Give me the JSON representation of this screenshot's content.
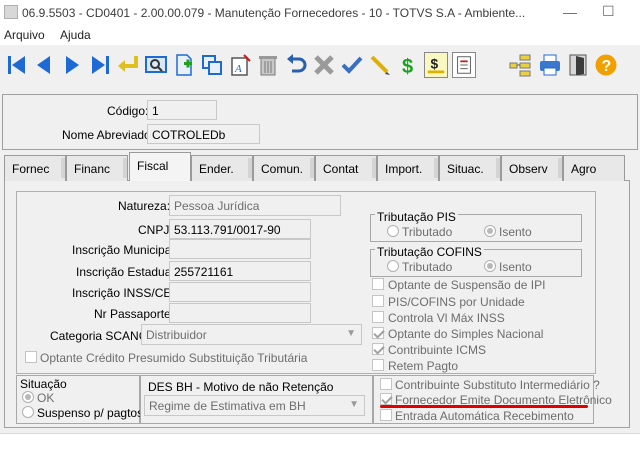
{
  "window": {
    "title": "06.9.5503 - CD0401 - 2.00.00.079 - Manutenção Fornecedores - 10 - TOTVS S.A - Ambiente...",
    "minimize": "—",
    "maximize": "☐",
    "close": "✕"
  },
  "menu": {
    "arquivo": "Arquivo",
    "ajuda": "Ajuda"
  },
  "header": {
    "codigo_label": "Código:",
    "codigo_value": "1",
    "nome_label": "Nome Abreviado:",
    "nome_value": "COTROLEDb"
  },
  "tabs": [
    "Fornec",
    "Financ",
    "Fiscal",
    "Ender.",
    "Comun.",
    "Contat",
    "Import.",
    "Situac.",
    "Observ",
    "Agro"
  ],
  "active_tab": "Fiscal",
  "fiscal": {
    "natureza_label": "Natureza:",
    "natureza_value": "Pessoa Jurídica",
    "cnpj_label": "CNPJ:",
    "cnpj_value": "53.113.791/0017-90",
    "insc_mun_label": "Inscrição Municipal:",
    "insc_mun_value": "",
    "insc_est_label": "Inscrição Estadual:",
    "insc_est_value": "255721161",
    "insc_inss_label": "Inscrição INSS/CEI:",
    "insc_inss_value": "",
    "passaporte_label": "Nr Passaporte:",
    "passaporte_value": "",
    "scanc_label": "Categoria SCANC:",
    "scanc_value": "Distribuidor",
    "optante_credito": "Optante Crédito Presumido Substituição Tributária"
  },
  "trib_pis": {
    "title": "Tributação PIS",
    "opt1": "Tributado",
    "opt2": "Isento",
    "selected": "Isento"
  },
  "trib_cofins": {
    "title": "Tributação COFINS",
    "opt1": "Tributado",
    "opt2": "Isento",
    "selected": "Isento"
  },
  "checks": [
    {
      "label": "Optante de Suspensão de IPI",
      "checked": false
    },
    {
      "label": "PIS/COFINS por Unidade",
      "checked": false
    },
    {
      "label": "Controla Vl Máx INSS",
      "checked": false
    },
    {
      "label": "Optante do Simples Nacional",
      "checked": true
    },
    {
      "label": "Contribuinte ICMS",
      "checked": true
    },
    {
      "label": "Retem Pagto",
      "checked": false
    }
  ],
  "situacao": {
    "title": "Situação",
    "opt1": "OK",
    "opt2": "Suspenso p/ pagtos",
    "selected": "OK"
  },
  "des_bh": {
    "title": "DES BH - Motivo de não Retenção",
    "value": "Regime de Estimativa em BH"
  },
  "checks2": [
    {
      "label": "Contribuinte Substituto Intermediário ?",
      "checked": false
    },
    {
      "label": "Fornecedor Emite Documento Eletrônico",
      "checked": true
    },
    {
      "label": "Entrada Automática Recebimento",
      "checked": false
    }
  ],
  "colors": {
    "highlight_underline": "#e00000",
    "toolbar_blue": "#1e6ad4",
    "help_orange": "#f0a000"
  }
}
